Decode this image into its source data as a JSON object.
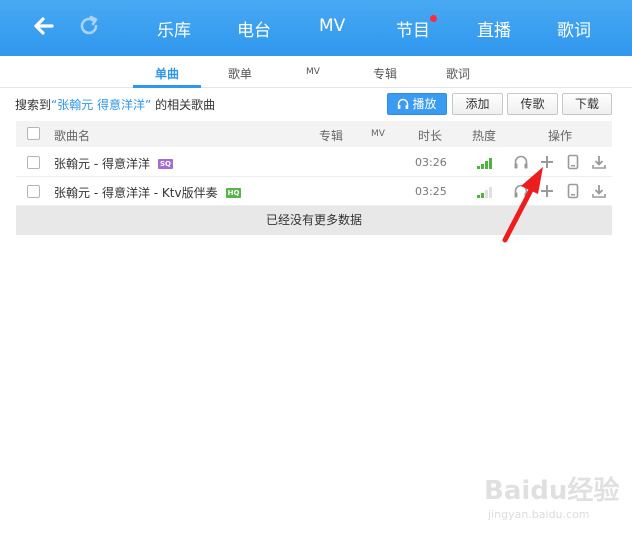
{
  "nav": {
    "items": [
      "乐库",
      "电台",
      "MV",
      "节目",
      "直播",
      "歌词"
    ],
    "has_notification": true
  },
  "tabs": {
    "items": [
      "单曲",
      "歌单",
      "MV",
      "专辑",
      "歌词"
    ],
    "active": "单曲"
  },
  "summary": {
    "prefix": "搜索到",
    "keyword": "“张翰元 得意洋洋”",
    "suffix": "的相关歌曲"
  },
  "toolbar": {
    "play_label": "播放",
    "add_label": "添加",
    "upload_label": "传歌",
    "download_label": "下载"
  },
  "table": {
    "columns": {
      "name": "歌曲名",
      "album": "专辑",
      "mv": "MV",
      "duration": "时长",
      "heat": "热度",
      "actions": "操作"
    },
    "rows": [
      {
        "title": "张翰元 - 得意洋洋",
        "badge": "SQ",
        "duration": "03:26",
        "heat_level": 4
      },
      {
        "title": "张翰元 - 得意洋洋 - Ktv版伴奏",
        "badge": "HQ",
        "duration": "03:25",
        "heat_level": 2
      }
    ],
    "no_more": "已经没有更多数据"
  },
  "watermark": {
    "brand": "Baidu经验",
    "url": "jingyan.baidu.com"
  },
  "colors": {
    "accent": "#2f97ee",
    "heat_active": "#4cb53a",
    "annotation_arrow": "#ee1d1d"
  }
}
